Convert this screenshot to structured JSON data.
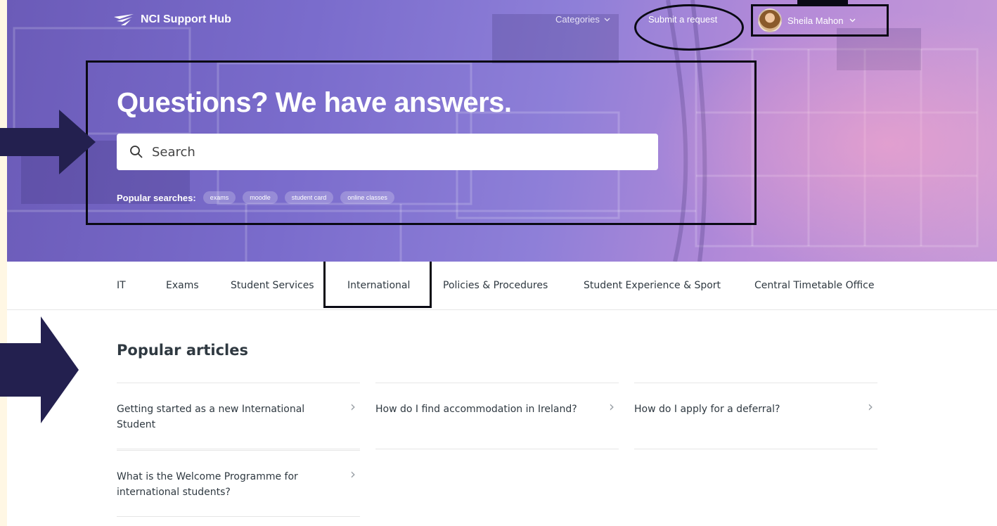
{
  "header": {
    "brand": "NCI Support Hub",
    "categories_label": "Categories",
    "submit_request_label": "Submit a request",
    "user_name": "Sheila Mahon"
  },
  "hero": {
    "headline": "Questions? We have answers.",
    "search_placeholder": "Search",
    "popular_searches_label": "Popular searches:",
    "popular_searches": [
      "exams",
      "moodle",
      "student card",
      "online classes"
    ]
  },
  "tabs": [
    "IT",
    "Exams",
    "Student Services",
    "International",
    "Policies & Procedures",
    "Student Experience & Sport",
    "Central Timetable Office"
  ],
  "articles": {
    "title": "Popular articles",
    "items": [
      "Getting started as a new International Student",
      "How do I find accommodation in Ireland?",
      "How do I apply for a deferral?",
      "What is the Welcome Programme for international students?"
    ]
  },
  "colors": {
    "hero_purple": "#7a6ccc",
    "annotation": "#0a0a14",
    "arrow_fill": "#23204f",
    "text": "#2f3941"
  },
  "icons": [
    "logo-mark-icon",
    "chevron-down-icon",
    "search-icon",
    "chevron-right-icon",
    "arrow-right-icon"
  ]
}
